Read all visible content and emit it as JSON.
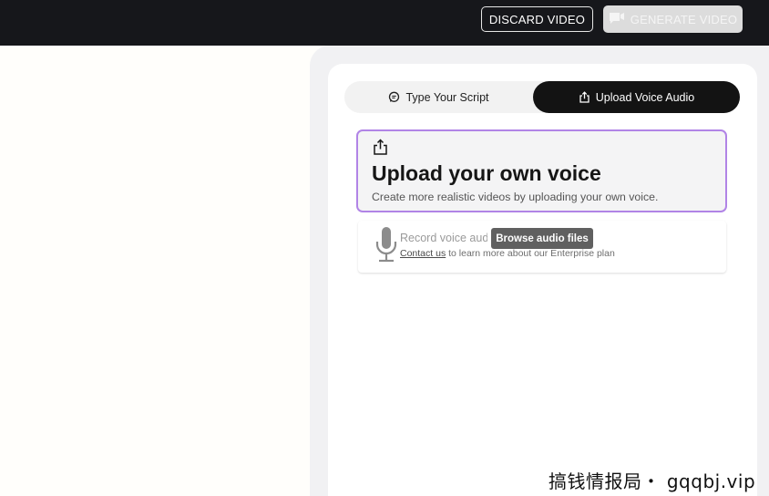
{
  "header": {
    "discard_label": "DISCARD VIDEO",
    "generate_label": "GENERATE VIDEO"
  },
  "tabs": [
    {
      "label": "Type Your Script",
      "icon": "chat-icon",
      "active": false
    },
    {
      "label": "Upload Voice Audio",
      "icon": "upload-icon",
      "active": true
    }
  ],
  "upload_voice": {
    "title": "Upload your own voice",
    "subtitle": "Create more realistic videos by uploading your own voice."
  },
  "record_voice": {
    "title": "Record voice audio",
    "contact_link": "Contact us",
    "subtitle_rest": " to learn more about our Enterprise plan"
  },
  "tooltip": {
    "text": "Browse audio files"
  },
  "watermark": {
    "text": "搞钱情报局・ gqqbj.vip"
  },
  "colors": {
    "topbar": "#16171b",
    "accent_border": "#b184e6",
    "active_tab": "#131313"
  }
}
